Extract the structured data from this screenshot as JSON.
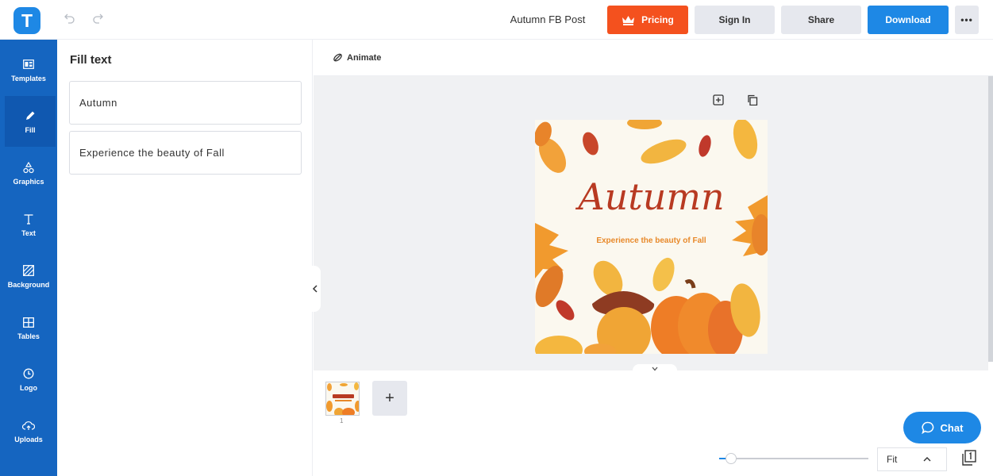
{
  "header": {
    "document_title": "Autumn FB Post",
    "pricing_label": "Pricing",
    "signin_label": "Sign In",
    "share_label": "Share",
    "download_label": "Download",
    "more_label": "•••",
    "logo_letter": "T"
  },
  "sidebar": {
    "items": [
      {
        "label": "Templates",
        "icon": "templates-icon"
      },
      {
        "label": "Fill",
        "icon": "pencil-icon"
      },
      {
        "label": "Graphics",
        "icon": "shapes-icon"
      },
      {
        "label": "Text",
        "icon": "text-icon"
      },
      {
        "label": "Background",
        "icon": "background-icon"
      },
      {
        "label": "Tables",
        "icon": "table-icon"
      },
      {
        "label": "Logo",
        "icon": "logo-icon"
      },
      {
        "label": "Uploads",
        "icon": "cloud-upload-icon"
      }
    ]
  },
  "panel": {
    "title": "Fill text",
    "fields": [
      "Autumn",
      "Experience the beauty of Fall"
    ]
  },
  "canvas_toolbar": {
    "animate_label": "Animate"
  },
  "design": {
    "title": "Autumn",
    "subtitle": "Experience the beauty of Fall"
  },
  "pages": {
    "page_number": "1",
    "add_label": "+"
  },
  "chat": {
    "label": "Chat"
  },
  "zoom": {
    "selected": "Fit"
  },
  "colors": {
    "brand_blue": "#1e88e5",
    "rail_blue": "#1565c0",
    "pricing_orange": "#f4511e",
    "title_red": "#b83a22",
    "subtitle_orange": "#e8892a"
  }
}
